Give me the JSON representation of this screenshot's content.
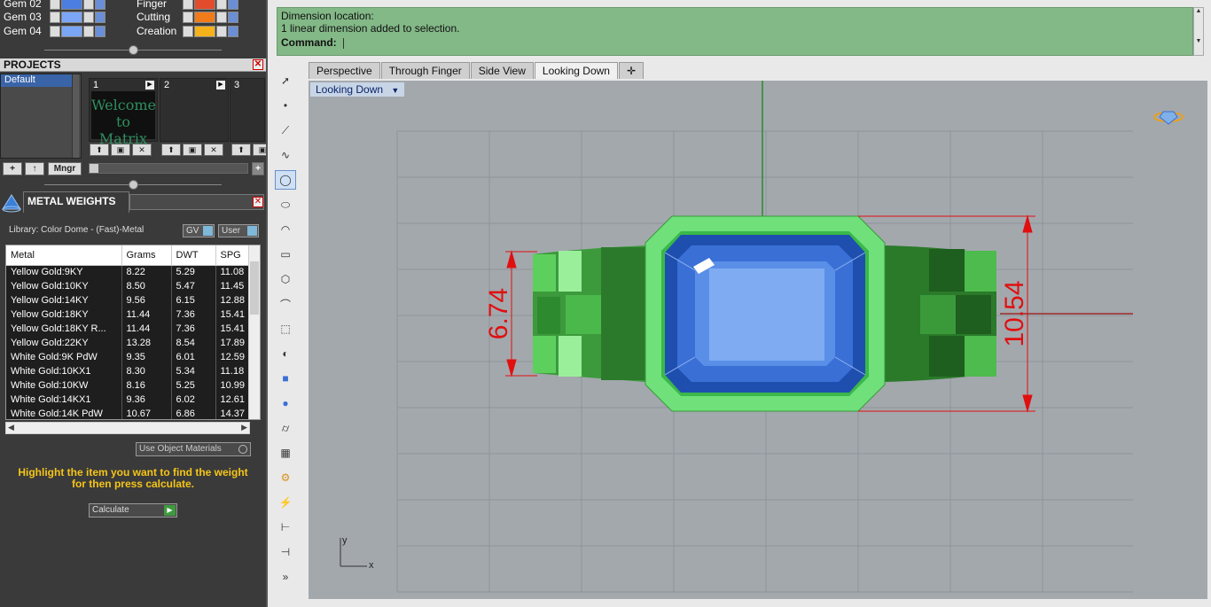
{
  "layers": {
    "left": [
      {
        "name": "Gem 02",
        "color": "#4c7de0"
      },
      {
        "name": "Gem 03",
        "color": "#7aa6f5"
      },
      {
        "name": "Gem 04",
        "color": "#7aa6f5"
      }
    ],
    "right": [
      {
        "name": "Finger",
        "color": "#e24b2b"
      },
      {
        "name": "Cutting",
        "color": "#f07b1b"
      },
      {
        "name": "Creation",
        "color": "#f5b21b"
      }
    ]
  },
  "projects": {
    "title": "PROJECTS",
    "list": [
      "Default"
    ],
    "slots": [
      {
        "num": "1",
        "thumb": "Welcome to Matrix"
      },
      {
        "num": "2",
        "thumb": ""
      },
      {
        "num": "3",
        "thumb": ""
      }
    ],
    "mngr_label": "Mngr"
  },
  "metal_weights": {
    "title": "METAL WEIGHTS",
    "library": "Library: Color Dome - (Fast)-Metal",
    "gv_label": "GV",
    "user_label": "User",
    "columns": [
      "Metal",
      "Grams",
      "DWT",
      "SPG"
    ],
    "rows": [
      [
        "Yellow Gold:9KY",
        "8.22",
        "5.29",
        "11.08"
      ],
      [
        "Yellow Gold:10KY",
        "8.50",
        "5.47",
        "11.45"
      ],
      [
        "Yellow Gold:14KY",
        "9.56",
        "6.15",
        "12.88"
      ],
      [
        "Yellow Gold:18KY",
        "11.44",
        "7.36",
        "15.41"
      ],
      [
        "Yellow Gold:18KY R...",
        "11.44",
        "7.36",
        "15.41"
      ],
      [
        "Yellow Gold:22KY",
        "13.28",
        "8.54",
        "17.89"
      ],
      [
        "White Gold:9K PdW",
        "9.35",
        "6.01",
        "12.59"
      ],
      [
        "White Gold:10KX1",
        "8.30",
        "5.34",
        "11.18"
      ],
      [
        "White Gold:10KW",
        "8.16",
        "5.25",
        "10.99"
      ],
      [
        "White Gold:14KX1",
        "9.36",
        "6.02",
        "12.61"
      ],
      [
        "White Gold:14K PdW",
        "10.67",
        "6.86",
        "14.37"
      ]
    ],
    "use_object_materials": "Use Object Materials",
    "hint": "Highlight the item you want to find the weight for then press calculate.",
    "calculate_label": "Calculate",
    "hint_color": "#f5c518"
  },
  "command": {
    "line1": "Dimension location:",
    "line2": "1 linear dimension added to selection.",
    "prompt": "Command:"
  },
  "tabs": [
    "Perspective",
    "Through Finger",
    "Side View",
    "Looking Down"
  ],
  "active_tab": "Looking Down",
  "viewport": {
    "label": "Looking Down",
    "dim_left": "6.74",
    "dim_right": "10.54",
    "axis_y": "y",
    "axis_x": "x",
    "colors": {
      "metal": "#4fc24f",
      "gem": "#4a7de0",
      "dimension": "#e01010",
      "grid": "#8f949a"
    }
  },
  "tools": [
    "select-arrow-icon",
    "point-icon",
    "polyline-icon",
    "curve-icon",
    "circle-icon",
    "ellipse-icon",
    "arc-icon",
    "rectangle-icon",
    "polygon-icon",
    "fillet-icon",
    "transform-icon",
    "revolve-icon",
    "box-icon",
    "sphere-icon",
    "cylinder-icon",
    "surface-icon",
    "gear-icon",
    "flash-icon",
    "measure-icon",
    "dimension-icon",
    "more-icon"
  ]
}
